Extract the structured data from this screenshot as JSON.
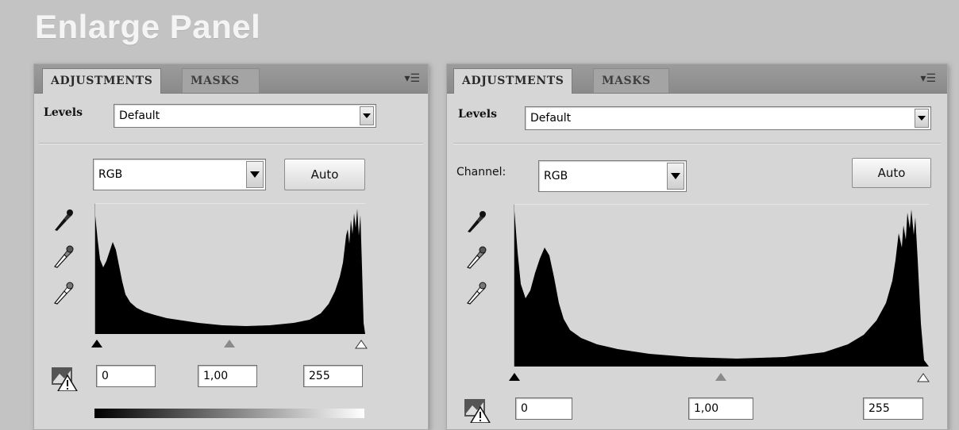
{
  "page_title": "Enlarge Panel",
  "left_panel": {
    "tabs": [
      {
        "label": "ADJUSTMENTS",
        "active": true
      },
      {
        "label": "MASKS",
        "active": false
      }
    ],
    "menu_icon": "panel-menu-icon",
    "adjustment_type": "Levels",
    "preset_value": "Default",
    "channel_value": "RGB",
    "auto_label": "Auto",
    "input_black": "0",
    "input_gamma": "1,00",
    "input_white": "255"
  },
  "right_panel": {
    "tabs": [
      {
        "label": "ADJUSTMENTS",
        "active": true
      },
      {
        "label": "MASKS",
        "active": false
      }
    ],
    "menu_icon": "panel-menu-icon",
    "adjustment_type": "Levels",
    "preset_value": "Default",
    "channel_label": "Channel:",
    "channel_value": "RGB",
    "auto_label": "Auto",
    "input_black": "0",
    "input_gamma": "1,00",
    "input_white": "255"
  },
  "colors": {
    "background": "#c3c3c3",
    "panel": "#d6d6d6",
    "tabbar": "#8e8e8e",
    "histogram": "#000000",
    "title": "#f4f4f4"
  }
}
